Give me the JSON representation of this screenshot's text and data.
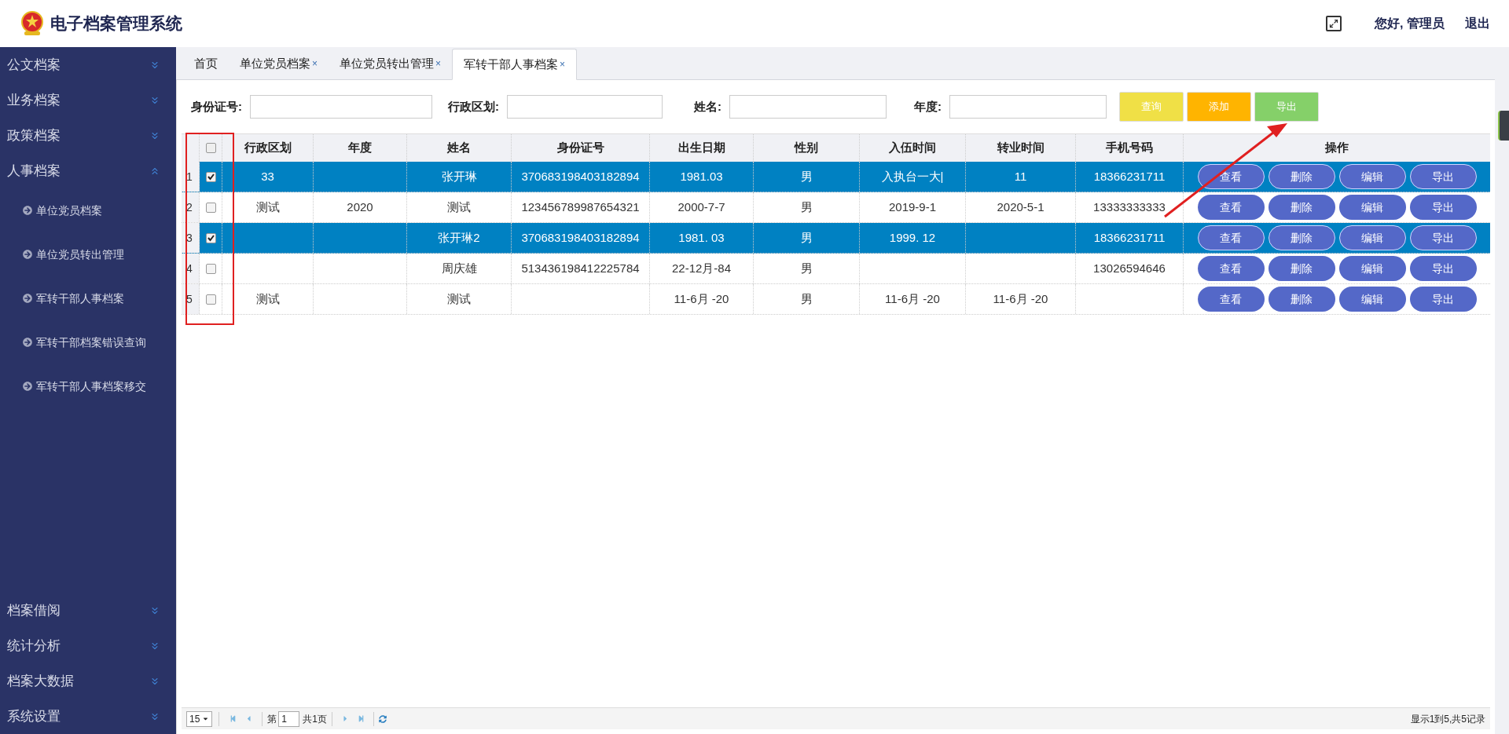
{
  "header": {
    "title": "电子档案管理系统",
    "greeting": "您好, 管理员",
    "logout": "退出"
  },
  "sidebar": {
    "menu": [
      {
        "label": "公文档案",
        "expanded": false
      },
      {
        "label": "业务档案",
        "expanded": false
      },
      {
        "label": "政策档案",
        "expanded": false
      },
      {
        "label": "人事档案",
        "expanded": true,
        "children": [
          {
            "label": "单位党员档案"
          },
          {
            "label": "单位党员转出管理"
          },
          {
            "label": "军转干部人事档案"
          },
          {
            "label": "军转干部档案错误查询"
          },
          {
            "label": "军转干部人事档案移交"
          }
        ]
      }
    ],
    "menu_bottom": [
      {
        "label": "档案借阅",
        "expanded": false
      },
      {
        "label": "统计分析",
        "expanded": false
      },
      {
        "label": "档案大数据",
        "expanded": false
      },
      {
        "label": "系统设置",
        "expanded": false
      }
    ]
  },
  "tabs": [
    {
      "label": "首页",
      "selected": false,
      "closable": false
    },
    {
      "label": "单位党员档案",
      "selected": false,
      "closable": true
    },
    {
      "label": "单位党员转出管理",
      "selected": false,
      "closable": true
    },
    {
      "label": "军转干部人事档案",
      "selected": true,
      "closable": true
    }
  ],
  "close_mark": "×",
  "search": {
    "fields": [
      {
        "label": "身份证号:"
      },
      {
        "label": "行政区划:"
      },
      {
        "label": "姓名:"
      },
      {
        "label": "年度:"
      }
    ],
    "buttons": [
      {
        "label": "查询",
        "color": "#f0e046"
      },
      {
        "label": "添加",
        "color": "#ffb400"
      },
      {
        "label": "导出",
        "color": "#85d069"
      }
    ]
  },
  "table": {
    "all_checked": false,
    "columns": [
      "行政区划",
      "年度",
      "姓名",
      "身份证号",
      "出生日期",
      "性别",
      "入伍时间",
      "转业时间",
      "手机号码"
    ],
    "actions_label": "操作",
    "rows": [
      {
        "index": "1",
        "selected": true,
        "cells": [
          "33",
          null,
          "张开琳",
          "370683198403182894",
          "1981.03",
          "男",
          "入执台一大|",
          "11",
          "18366231711"
        ],
        "actions": [
          "查看",
          "删除",
          "编辑",
          "导出"
        ]
      },
      {
        "index": "2",
        "selected": false,
        "cells": [
          "测试",
          "2020",
          "测试",
          "123456789987654321",
          "2000-7-7",
          "男",
          "2019-9-1",
          "2020-5-1",
          "13333333333"
        ],
        "actions": [
          "查看",
          "删除",
          "编辑",
          "导出"
        ]
      },
      {
        "index": "3",
        "selected": true,
        "cells": [
          null,
          null,
          "张开琳2",
          "370683198403182894",
          "1981. 03",
          "男",
          "1999. 12",
          null,
          "18366231711"
        ],
        "actions": [
          "查看",
          "删除",
          "编辑",
          "导出"
        ]
      },
      {
        "index": "4",
        "selected": false,
        "cells": [
          null,
          null,
          "周庆雄",
          "513436198412225784",
          "22-12月-84",
          "男",
          null,
          null,
          "13026594646"
        ],
        "actions": [
          "查看",
          "删除",
          "编辑",
          "导出"
        ]
      },
      {
        "index": "5",
        "selected": false,
        "cells": [
          "测试",
          null,
          "测试",
          null,
          "11-6月 -20",
          "男",
          "11-6月 -20",
          "11-6月 -20",
          null
        ],
        "actions": [
          "查看",
          "删除",
          "编辑",
          "导出"
        ]
      }
    ]
  },
  "pager": {
    "page_size": "15",
    "page_prefix": "第",
    "page": "1",
    "page_total": "共1页",
    "summary": "显示1到5,共5记录"
  }
}
